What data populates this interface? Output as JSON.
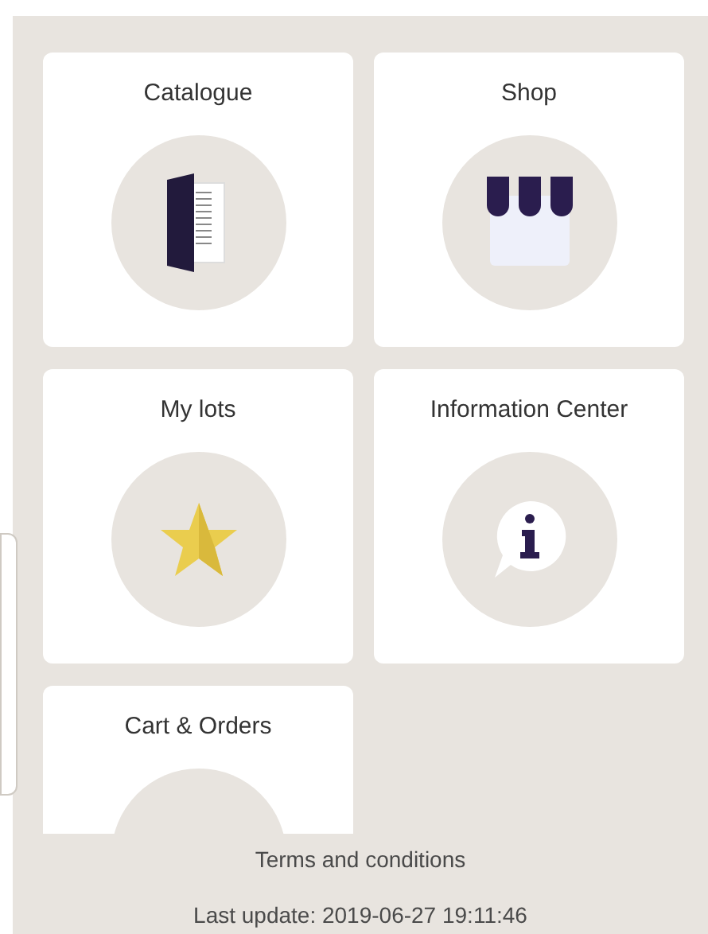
{
  "tiles": [
    {
      "label": "Catalogue",
      "kind": "catalogue"
    },
    {
      "label": "Shop",
      "kind": "shop"
    },
    {
      "label": "My lots",
      "kind": "star"
    },
    {
      "label": "Information Center",
      "kind": "info"
    },
    {
      "label": "Cart & Orders",
      "kind": "cart"
    }
  ],
  "footer": {
    "link": "Terms and conditions",
    "last_update": "Last update: 2019-06-27 19:11:46"
  }
}
